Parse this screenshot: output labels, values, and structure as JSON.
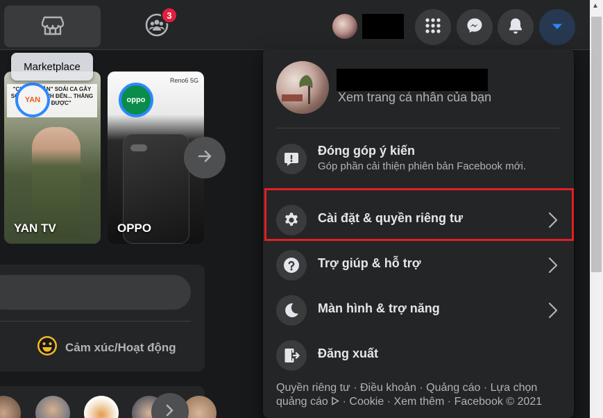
{
  "topbar": {
    "groups_badge": "3",
    "tooltip": "Marketplace"
  },
  "stories": [
    {
      "label": "YAN TV",
      "avatar_text": "YAN"
    },
    {
      "label": "OPPO",
      "avatar_text": "oppo",
      "corner_text": "Reno6 5G"
    }
  ],
  "story1_overlay": "\"CHIẾN NHÂN\" SOÁI CA GÂY SỐT... CHỜ ANH ĐẾN... THẮNG CÔNG ĐƯỢC\"",
  "composer": {
    "feeling_label": "Cảm xúc/Hoạt động"
  },
  "menu": {
    "profile_subtitle": "Xem trang cá nhân của bạn",
    "items": [
      {
        "label": "Đóng góp ý kiến",
        "sub": "Góp phần cải thiện phiên bản Facebook mới.",
        "icon": "feedback-icon",
        "chevron": false
      },
      {
        "label": "Cài đặt & quyền riêng tư",
        "icon": "gear-icon",
        "chevron": true
      },
      {
        "label": "Trợ giúp & hỗ trợ",
        "icon": "help-icon",
        "chevron": true
      },
      {
        "label": "Màn hình & trợ năng",
        "icon": "moon-icon",
        "chevron": true
      },
      {
        "label": "Đăng xuất",
        "icon": "logout-icon",
        "chevron": false
      }
    ],
    "footer_line1": "Quyền riêng tư · Điều khoản · Quảng cáo · Lựa chọn",
    "footer_line2a": "quảng cáo",
    "footer_line2b": "· Cookie · Xem thêm · Facebook © 2021"
  },
  "colors": {
    "accent": "#2d88ff",
    "highlight": "#e41e25",
    "badge": "#e41e3f"
  }
}
